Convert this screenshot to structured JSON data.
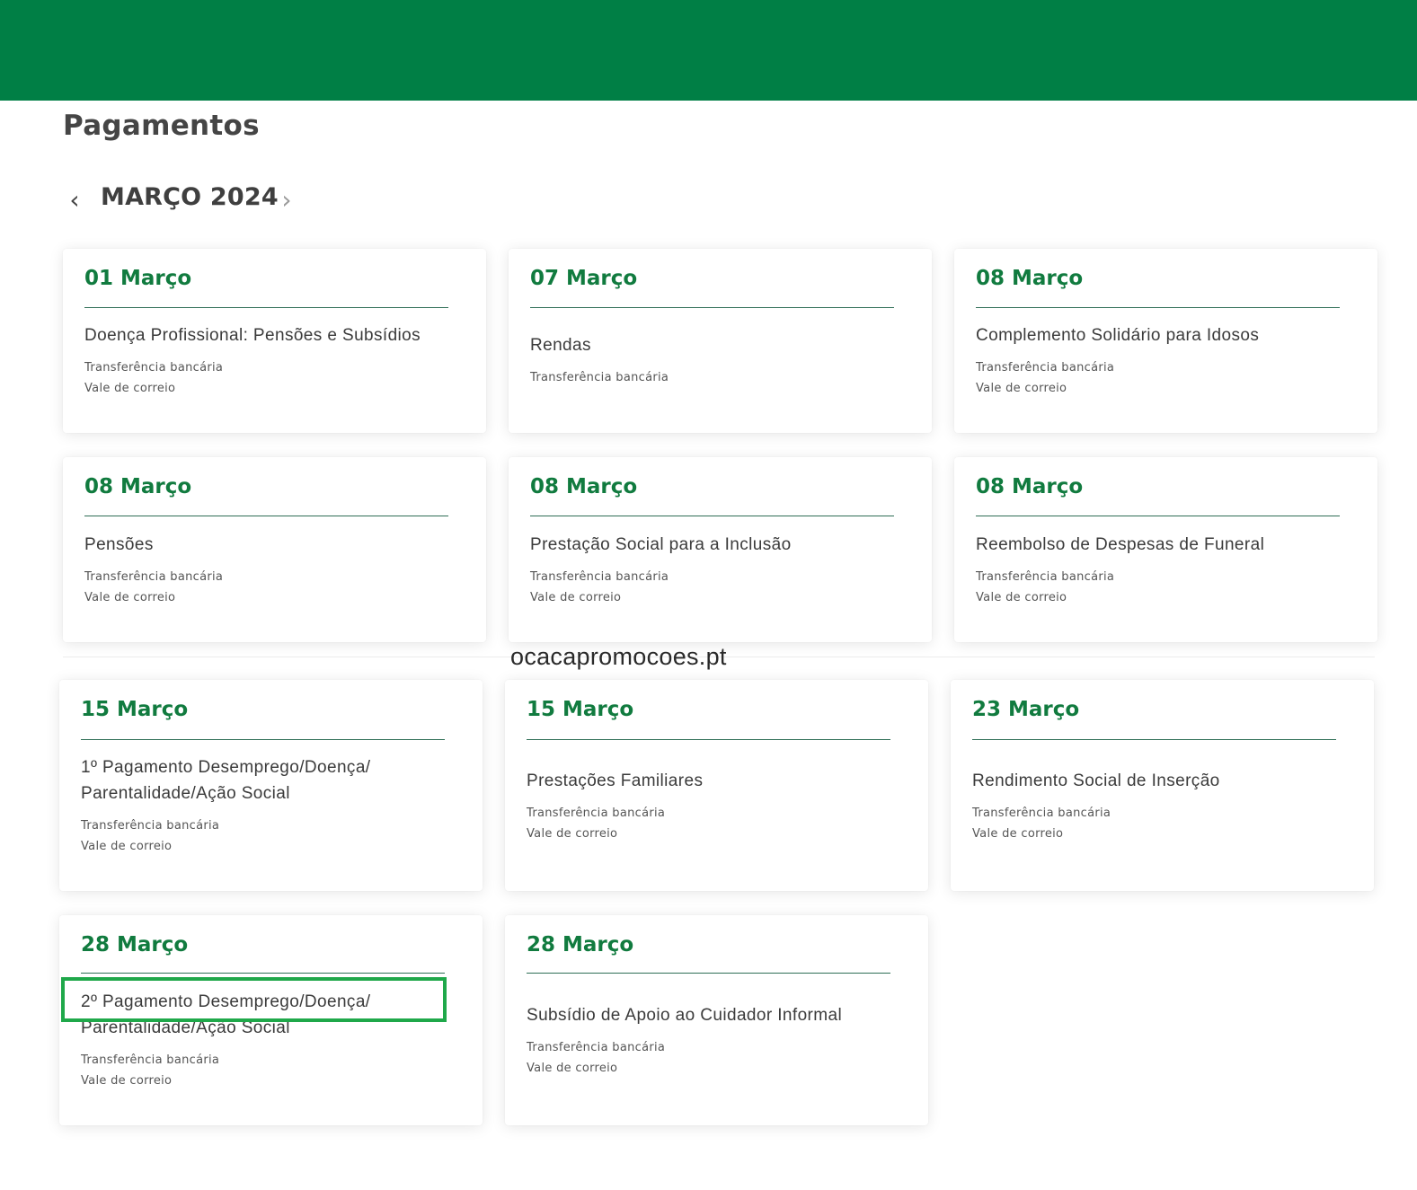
{
  "page": {
    "title": "Pagamentos",
    "month": "MARÇO 2024",
    "prev_icon": "‹",
    "next_icon": "›",
    "watermark": "ocacapromocoes.pt"
  },
  "colors": {
    "header_bar": "#007f45",
    "date_text": "#117b3f",
    "highlight": "#1fa84a"
  },
  "cards": [
    {
      "date": "01 Março",
      "title": "Doença Profissional: Pensões e Subsídios",
      "methods": [
        "Transferência bancária",
        "Vale de correio"
      ]
    },
    {
      "date": "07 Março",
      "title": "Rendas",
      "methods": [
        "Transferência bancária"
      ]
    },
    {
      "date": "08 Março",
      "title": "Complemento Solidário para Idosos",
      "methods": [
        "Transferência bancária",
        "Vale de correio"
      ]
    },
    {
      "date": "08 Março",
      "title": "Pensões",
      "methods": [
        "Transferência bancária",
        "Vale de correio"
      ]
    },
    {
      "date": "08 Março",
      "title": "Prestação Social para a Inclusão",
      "methods": [
        "Transferência bancária",
        "Vale de correio"
      ]
    },
    {
      "date": "08 Março",
      "title": "Reembolso de Despesas de Funeral",
      "methods": [
        "Transferência bancária",
        "Vale de correio"
      ]
    },
    {
      "date": "15 Março",
      "title": "1º Pagamento Desemprego/Doença/ Parentalidade/Ação Social",
      "methods": [
        "Transferência bancária",
        "Vale de correio"
      ]
    },
    {
      "date": "15 Março",
      "title": "Prestações Familiares",
      "methods": [
        "Transferência bancária",
        "Vale de correio"
      ]
    },
    {
      "date": "23 Março",
      "title": "Rendimento Social de Inserção",
      "methods": [
        "Transferência bancária",
        "Vale de correio"
      ]
    },
    {
      "date": "28 Março",
      "title": "2º Pagamento Desemprego/Doença/ Parentalidade/Ação Social",
      "methods": [
        "Transferência bancária",
        "Vale de correio"
      ]
    },
    {
      "date": "28 Março",
      "title": "Subsídio de Apoio ao Cuidador Informal",
      "methods": [
        "Transferência bancária",
        "Vale de correio"
      ]
    }
  ]
}
